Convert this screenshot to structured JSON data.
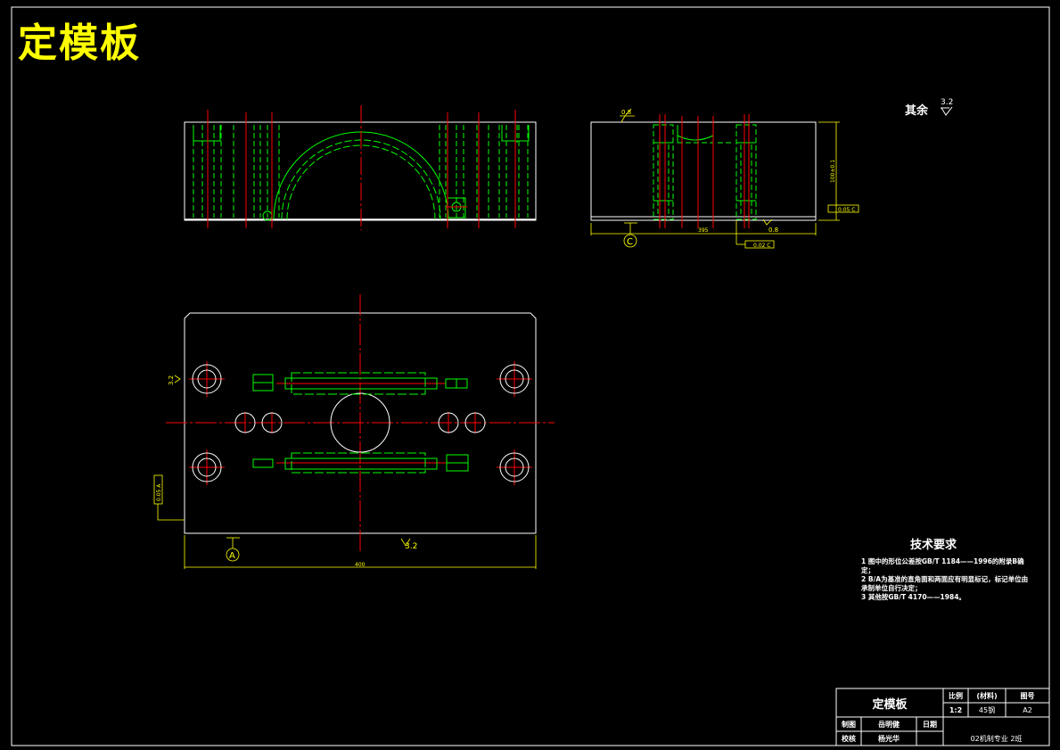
{
  "drawing": {
    "title": "定模板",
    "roughness_note": "其余",
    "roughness_value": "3.2",
    "technical_requirements": {
      "heading": "技术要求",
      "items": [
        "1  图中的形位公差按GB/T 1184——1996的附录B确定；",
        "2  B/A为基准的直角面和两面应有明显标记，标记单位由承制单位自行决定；",
        "3  其他按GB/T 4170——1984。"
      ]
    },
    "title_block": {
      "part_name": "定模板",
      "scale_label": "比例",
      "scale_value": "1:2",
      "material_label": "(材料)",
      "material_value": "45钢",
      "drawing_no_label": "图号",
      "drawing_no_value": "A2",
      "drawn_by_label": "制图",
      "drawn_by_name": "岳明健",
      "date_label": "日期",
      "checked_by_label": "校核",
      "checked_by_name": "杨光华",
      "school": "02机制专业 2班"
    },
    "annotations": {
      "front_roughness": "0.8",
      "side_roughness": "0.8",
      "side_width_dim": "395",
      "side_height_dim": "100±0.1",
      "tol_frame_right": "0.05 C",
      "tol_frame_bottom": "0.02 C",
      "datum_c": "C",
      "datum_a": "A",
      "plan_width_dim": "400",
      "plan_roughness_left": "3.2",
      "plan_roughness_bottom": "3.2",
      "plan_tol_frame": "0.05 A"
    },
    "colors": {
      "background": "#000000",
      "outline": "#ffffff",
      "hidden": "#00ff00",
      "center": "#ff0000",
      "dimension": "#ffff00"
    }
  }
}
